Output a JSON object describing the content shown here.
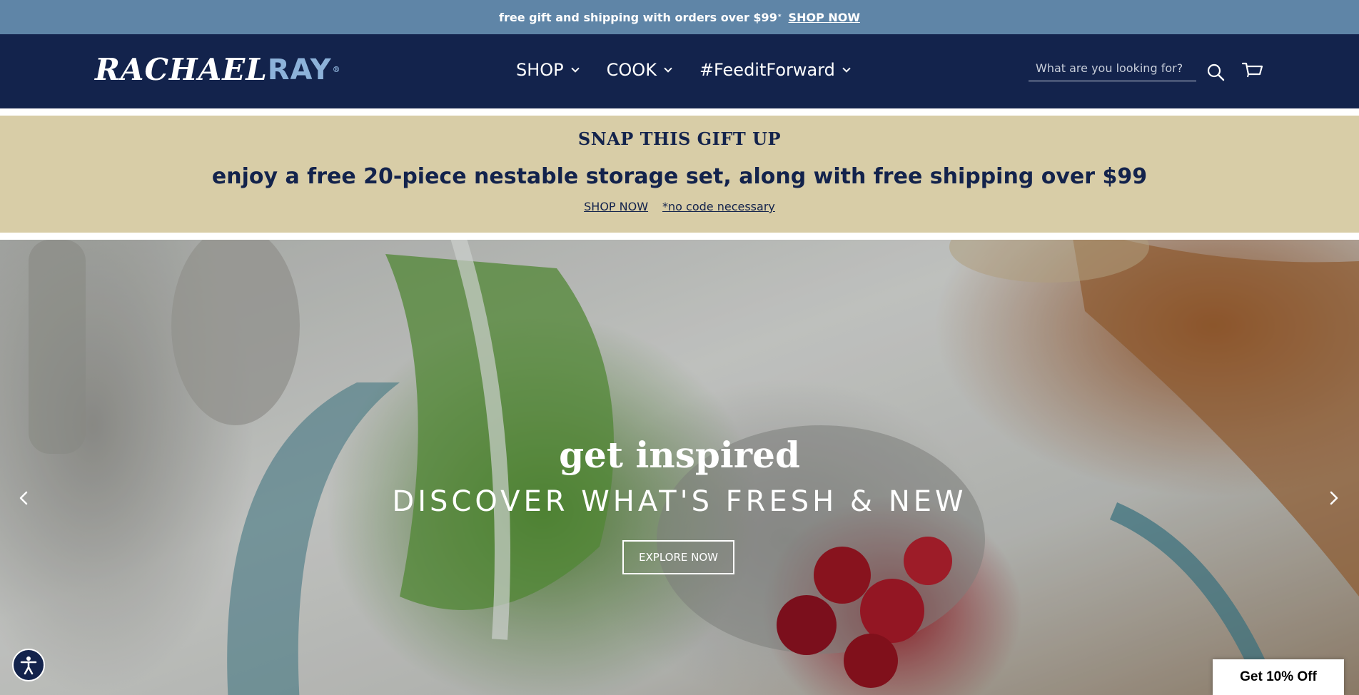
{
  "announcement": {
    "text": "free gift and shipping with orders over $99",
    "sup": "*",
    "link": "SHOP NOW"
  },
  "header": {
    "logo_part_a": "RACHAEL",
    "logo_part_b": "RAY",
    "logo_reg": "®",
    "nav": [
      {
        "label": "SHOP"
      },
      {
        "label": "COOK"
      },
      {
        "label": "#FeeditForward"
      }
    ],
    "search_placeholder": "What are you looking for?"
  },
  "promo": {
    "kicker": "SNAP THIS GIFT UP",
    "headline": "enjoy a free 20-piece nestable storage set, along with free shipping over $99",
    "shop_link": "SHOP NOW",
    "note": "*no code necessary"
  },
  "hero": {
    "title": "get inspired",
    "subtitle": "DISCOVER WHAT'S FRESH & NEW",
    "button": "EXPLORE NOW"
  },
  "popup": {
    "discount_label": "Get 10% Off"
  },
  "colors": {
    "announcement_bg": "#5f85a7",
    "header_bg": "#13234c",
    "promo_bg": "#d8cda7",
    "logo_accent": "#8db2d9"
  },
  "icons": [
    "search-icon",
    "cart-icon",
    "chevron-down-icon",
    "chevron-left-icon",
    "chevron-right-icon",
    "accessibility-icon"
  ]
}
